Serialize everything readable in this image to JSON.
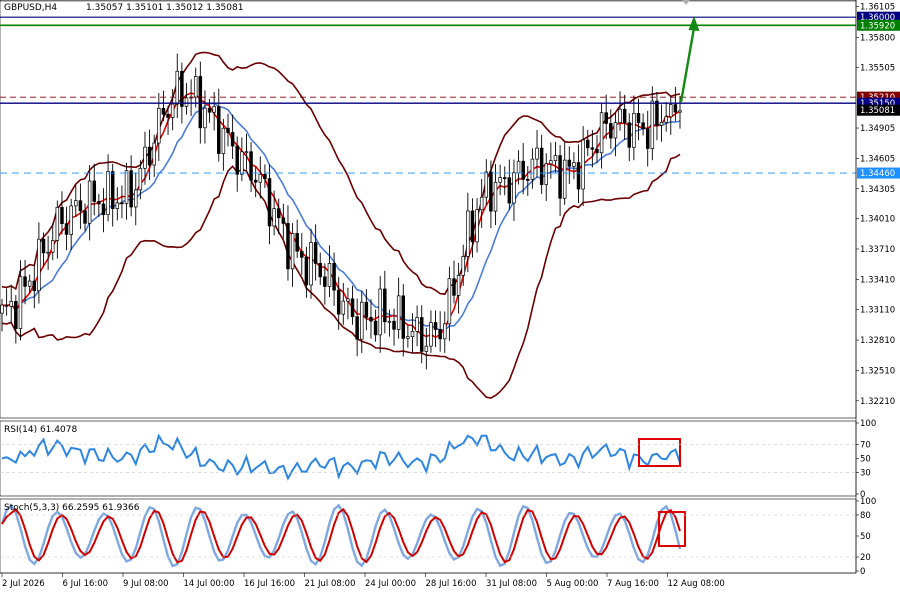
{
  "header": {
    "symbol": "GBPUSD,H4",
    "ohlc": "1.35057 1.35101 1.35012 1.35081"
  },
  "price_axis": {
    "ticks": [
      "1.36105",
      "1.35800",
      "1.35505",
      "1.34905",
      "1.34605",
      "1.34305",
      "1.34010",
      "1.33710",
      "1.33410",
      "1.33110",
      "1.32810",
      "1.32510",
      "1.32210"
    ],
    "tags": [
      {
        "label": "1.36000",
        "color": "#000080"
      },
      {
        "label": "1.35920",
        "color": "#008000"
      },
      {
        "label": "1.35210",
        "color": "#800000"
      },
      {
        "label": "1.35150",
        "color": "#000080"
      },
      {
        "label": "1.35081",
        "color": "#000000"
      },
      {
        "label": "1.34460",
        "color": "#1e90ff"
      }
    ]
  },
  "rsi_panel": {
    "title": "RSI(14) 61.4078",
    "ticks": [
      "100",
      "70",
      "50",
      "30",
      "0"
    ]
  },
  "stoch_panel": {
    "title": "Stoch(5,3,3) 66.2595 61.9366",
    "ticks": [
      "100",
      "80",
      "50",
      "20",
      "0"
    ]
  },
  "time_axis": {
    "labels": [
      "2 Jul 2026",
      "6 Jul 16:00",
      "9 Jul 08:00",
      "14 Jul 00:00",
      "16 Jul 16:00",
      "21 Jul 08:00",
      "24 Jul 00:00",
      "28 Jul 16:00",
      "31 Jul 08:00",
      "5 Aug 00:00",
      "7 Aug 16:00",
      "12 Aug 08:00"
    ]
  },
  "colors": {
    "candle": "#000000",
    "bb": "#6b0000",
    "ma_fast": "#e00000",
    "ma_slow": "#4a7cd6",
    "rsi": "#2e86de",
    "stoch_main": "#7fa8e0",
    "stoch_signal": "#d00000",
    "arrow": "#138a13",
    "box": "#e00000"
  },
  "chart_data": {
    "type": "line",
    "title": "GBPUSD,H4",
    "ylim": [
      1.3206,
      1.3615
    ],
    "x": [
      "2 Jul 2026",
      "6 Jul 16:00",
      "9 Jul 08:00",
      "14 Jul 00:00",
      "16 Jul 16:00",
      "21 Jul 08:00",
      "24 Jul 00:00",
      "28 Jul 16:00",
      "31 Jul 08:00",
      "5 Aug 00:00",
      "7 Aug 16:00",
      "12 Aug 08:00"
    ],
    "series": [
      {
        "values": [
          1.33,
          1.34,
          1.343,
          1.353,
          1.345,
          1.335,
          1.33,
          1.329,
          1.344,
          1.345,
          1.349,
          1.3508
        ]
      }
    ],
    "levels": [
      {
        "value": 1.36
      },
      {
        "value": 1.3592
      },
      {
        "value": 1.3521
      },
      {
        "value": 1.3515
      },
      {
        "value": 1.3446
      }
    ]
  }
}
